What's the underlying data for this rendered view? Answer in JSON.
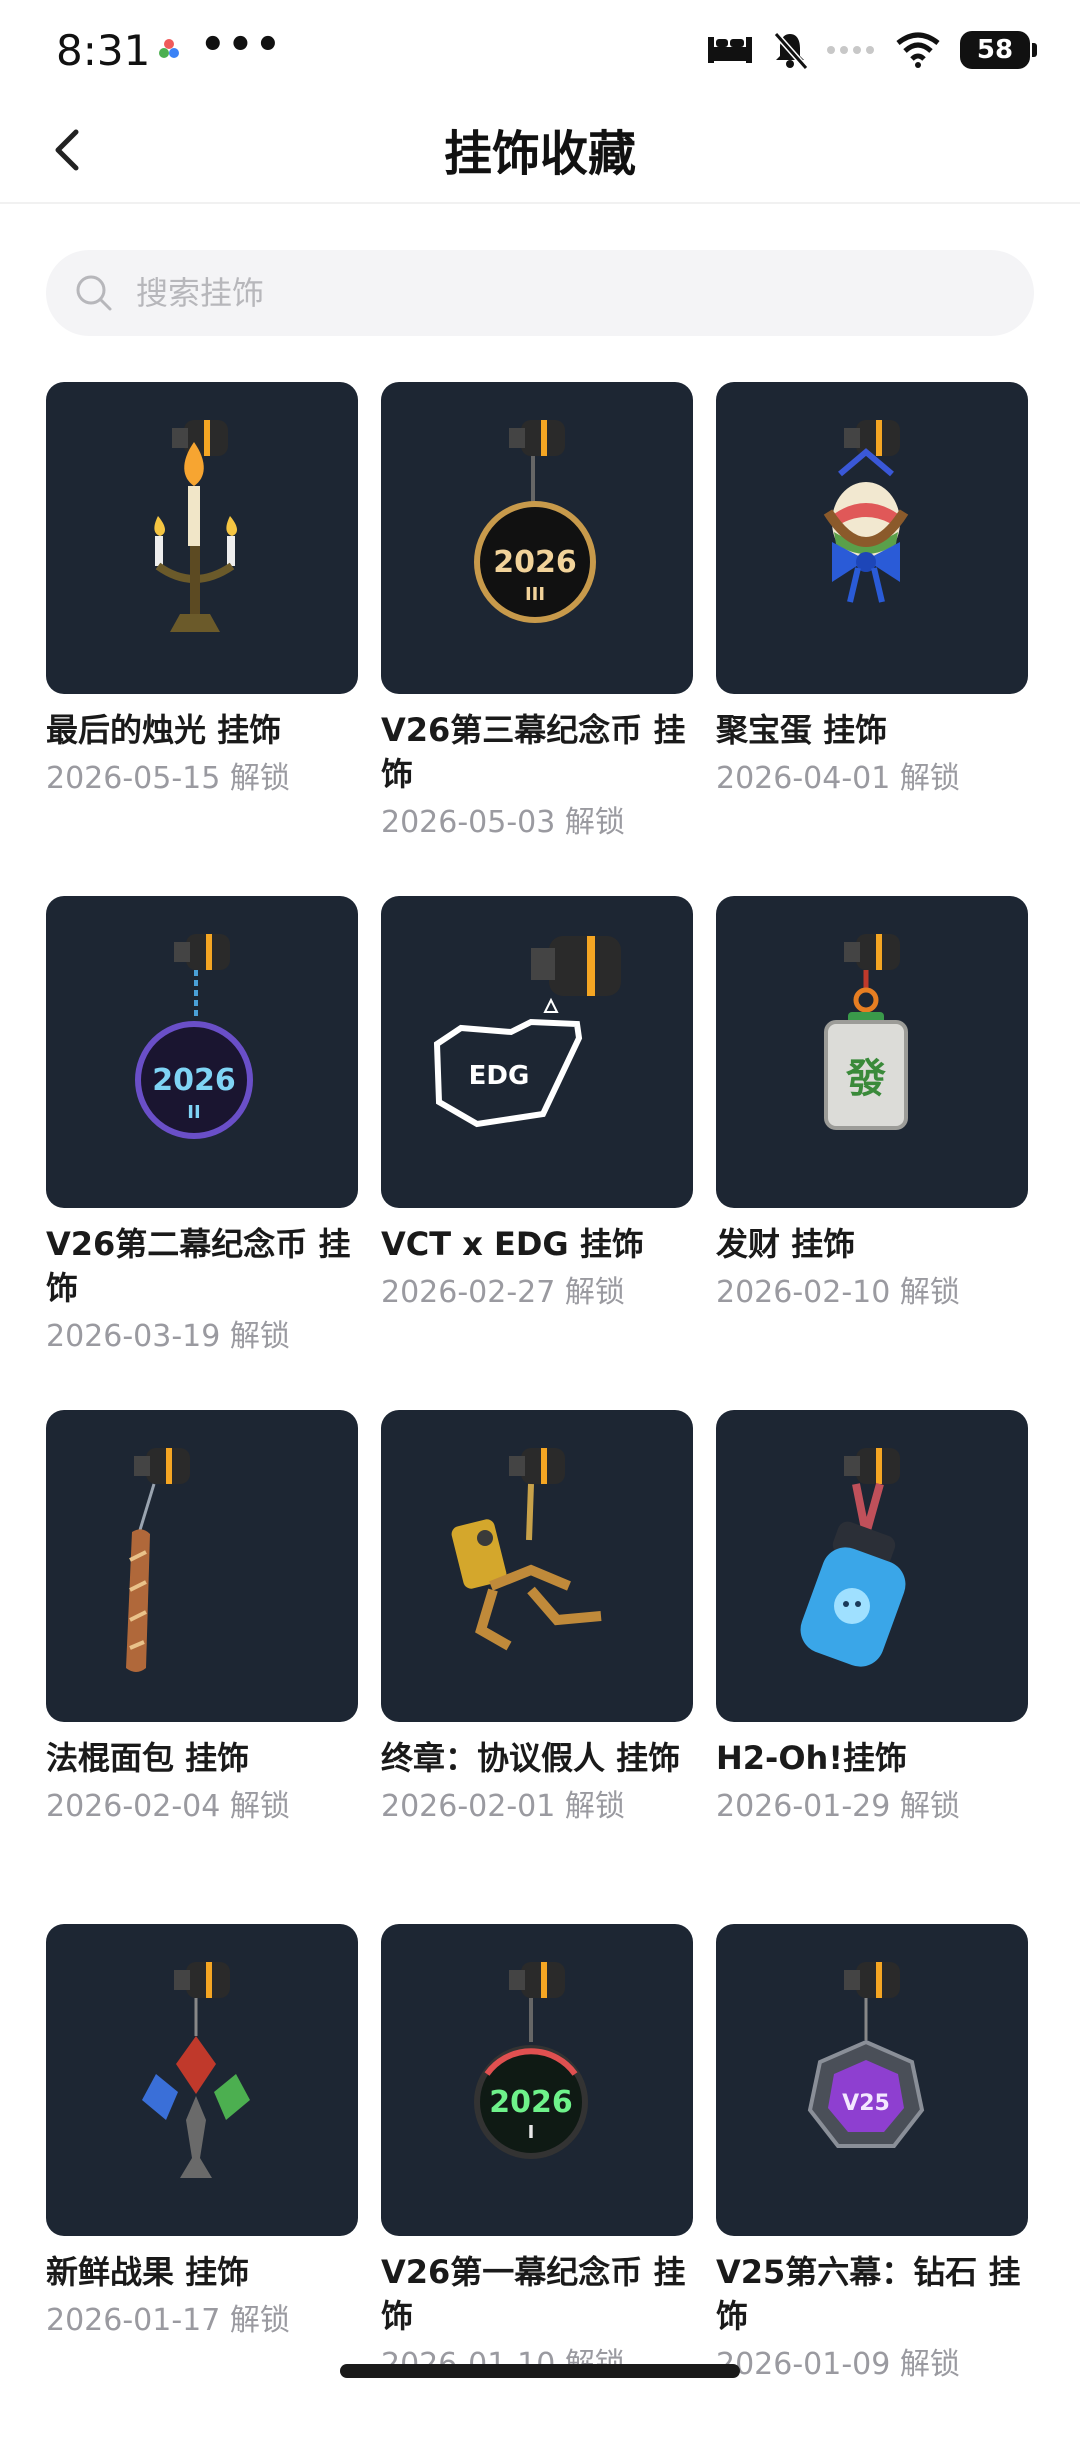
{
  "status": {
    "time": "8:31",
    "dots": "•••",
    "battery": "58"
  },
  "header": {
    "title": "挂饰收藏"
  },
  "search": {
    "placeholder": "搜索挂饰"
  },
  "items": [
    {
      "name": "最后的烛光 挂饰",
      "date": "2026-05-15 解锁",
      "icon": "candelabra-icon"
    },
    {
      "name": "V26第三幕纪念币 挂饰",
      "date": "2026-05-03 解锁",
      "icon": "coin-2026-iii-icon"
    },
    {
      "name": "聚宝蛋 挂饰",
      "date": "2026-04-01 解锁",
      "icon": "egg-basket-icon"
    },
    {
      "name": "V26第二幕纪念币 挂饰",
      "date": "2026-03-19 解锁",
      "icon": "coin-2026-ii-icon"
    },
    {
      "name": "VCT x EDG 挂饰",
      "date": "2026-02-27 解锁",
      "icon": "edg-logo-icon"
    },
    {
      "name": "发财 挂饰",
      "date": "2026-02-10 解锁",
      "icon": "mahjong-tile-icon"
    },
    {
      "name": "法棍面包 挂饰",
      "date": "2026-02-04 解锁",
      "icon": "baguette-icon"
    },
    {
      "name": "终章：协议假人 挂饰",
      "date": "2026-02-01 解锁",
      "icon": "robot-dummy-icon"
    },
    {
      "name": "H2-Oh!挂饰",
      "date": "2026-01-29 解锁",
      "icon": "water-bottle-icon"
    },
    {
      "name": "新鲜战果 挂饰",
      "date": "2026-01-17 解锁",
      "icon": "leaf-trophy-icon"
    },
    {
      "name": "V26第一幕纪念币 挂饰",
      "date": "2026-01-10 解锁",
      "icon": "coin-2026-i-icon"
    },
    {
      "name": "V25第六幕：钻石 挂饰",
      "date": "2026-01-09 解锁",
      "icon": "v25-diamond-icon"
    }
  ],
  "thumb_texts": {
    "coin3": "2026",
    "coin3_sub": "III",
    "coin2": "2026",
    "coin2_sub": "II",
    "coin1": "2026",
    "coin1_sub": "I",
    "edg": "EDG",
    "mahjong": "發",
    "v25": "V25"
  },
  "colors": {
    "thumb_bg": "#1d2633",
    "accent_orange": "#f5a623"
  }
}
